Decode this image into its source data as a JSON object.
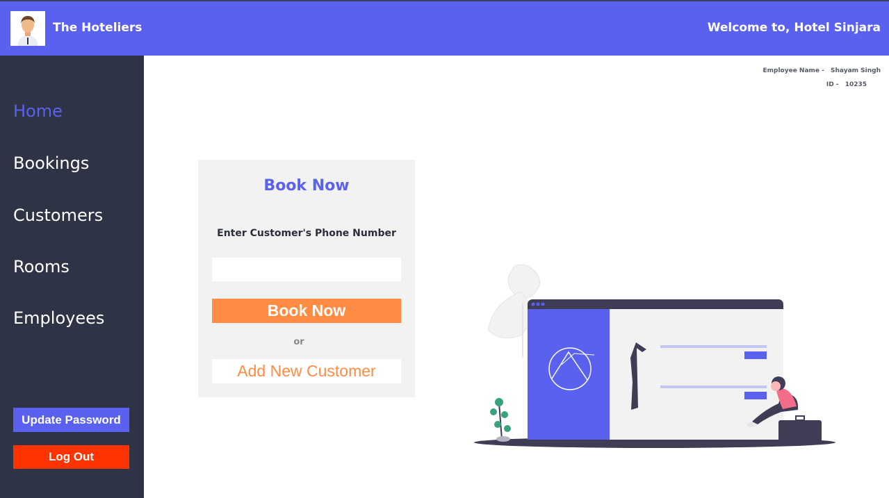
{
  "header": {
    "brand": "The Hoteliers",
    "welcome": "Welcome to, Hotel Sinjara"
  },
  "sidebar": {
    "items": [
      {
        "label": "Home",
        "active": true
      },
      {
        "label": "Bookings",
        "active": false
      },
      {
        "label": "Customers",
        "active": false
      },
      {
        "label": "Rooms",
        "active": false
      },
      {
        "label": "Employees",
        "active": false
      }
    ],
    "update_password": "Update Password",
    "logout": "Log Out"
  },
  "employee": {
    "name_label": "Employee Name -",
    "name": "Shayam Singh",
    "id_label": "ID -",
    "id": "10235"
  },
  "booking": {
    "title": "Book Now",
    "prompt": "Enter Customer's Phone Number",
    "phone_value": "",
    "book_button": "Book Now",
    "or": "or",
    "add_customer": "Add New Customer"
  },
  "colors": {
    "accent": "#5a61ee",
    "sidebar": "#2e3445",
    "orange": "#ff8c42",
    "logout": "#ff3300"
  },
  "icons": {
    "avatar": "person-avatar-icon",
    "illustration": "booking-illustration"
  }
}
